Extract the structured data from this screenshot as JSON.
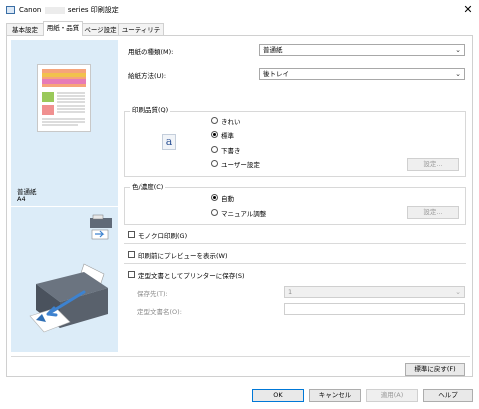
{
  "window": {
    "title_prefix": "Canon",
    "title_suffix": "series 印刷設定",
    "close_glyph": "✕"
  },
  "tabs": [
    {
      "label": "基本設定"
    },
    {
      "label": "用紙・品質"
    },
    {
      "label": "ページ設定"
    },
    {
      "label": "ユーティリティ"
    }
  ],
  "active_tab": 1,
  "media": {
    "label": "用紙の種類(M):",
    "value": "普通紙"
  },
  "feed": {
    "label": "給紙方法(U):",
    "value": "後トレイ"
  },
  "quality": {
    "group_label": "印刷品質(Q)",
    "icon_letter": "a",
    "options": [
      {
        "label": "きれい",
        "selected": false
      },
      {
        "label": "標準",
        "selected": true
      },
      {
        "label": "下書き",
        "selected": false
      },
      {
        "label": "ユーザー設定",
        "selected": false
      }
    ],
    "settings_button": "設定..."
  },
  "color": {
    "group_label": "色/濃度(C)",
    "options": [
      {
        "label": "自動",
        "selected": true
      },
      {
        "label": "マニュアル調整",
        "selected": false
      }
    ],
    "settings_button": "設定..."
  },
  "left_pane": {
    "media_name": "普通紙",
    "paper_size": "A4"
  },
  "checkboxes": {
    "mono": "モノクロ印刷(G)",
    "preview": "印刷前にプレビューを表示(W)",
    "save_profile": "定型文書としてプリンターに保存(S)"
  },
  "save": {
    "dest_label": "保存先(T):",
    "dest_value": "1",
    "name_label": "定型文書名(O):"
  },
  "buttons": {
    "defaults": "標準に戻す(F)",
    "ok": "OK",
    "cancel": "キャンセル",
    "apply": "適用(A)",
    "help": "ヘルプ"
  },
  "colors": {
    "left_pane_bg": "#dcecf8",
    "accent_blue": "#0078d7",
    "arrow_blue": "#3d82cf"
  }
}
